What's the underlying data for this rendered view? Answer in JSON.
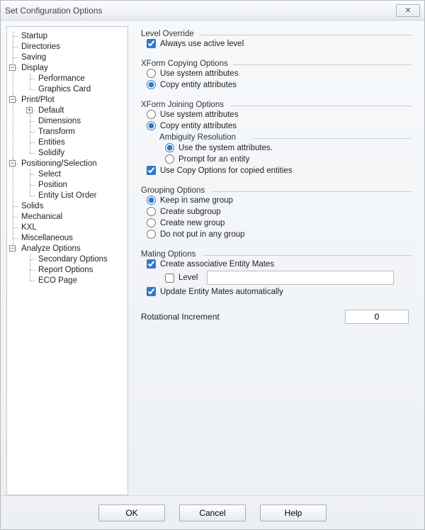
{
  "window": {
    "title": "Set Configuration Options"
  },
  "tree": {
    "items": [
      {
        "label": "Startup"
      },
      {
        "label": "Directories"
      },
      {
        "label": "Saving"
      },
      {
        "label": "Display",
        "expander": "-",
        "children": [
          {
            "label": "Performance"
          },
          {
            "label": "Graphics Card"
          }
        ]
      },
      {
        "label": "Print/Plot",
        "expander": "-",
        "children": [
          {
            "label": "Default",
            "expander": "+"
          },
          {
            "label": "Dimensions"
          },
          {
            "label": "Transform"
          },
          {
            "label": "Entities"
          },
          {
            "label": "Solidify"
          }
        ]
      },
      {
        "label": "Positioning/Selection",
        "expander": "-",
        "children": [
          {
            "label": "Select"
          },
          {
            "label": "Position"
          },
          {
            "label": "Entity List Order"
          }
        ]
      },
      {
        "label": "Solids"
      },
      {
        "label": "Mechanical"
      },
      {
        "label": "KXL"
      },
      {
        "label": "Miscellaneous"
      },
      {
        "label": "Analyze Options",
        "expander": "-",
        "children": [
          {
            "label": "Secondary Options"
          },
          {
            "label": "Report Options"
          },
          {
            "label": "ECO Page"
          }
        ]
      }
    ]
  },
  "sections": {
    "levelOverride": {
      "legend": "Level Override",
      "alwaysActive": {
        "label": "Always use active level",
        "checked": true
      }
    },
    "xformCopy": {
      "legend": "XForm Copying Options",
      "useSystem": {
        "label": "Use system attributes",
        "selected": false
      },
      "copyEntity": {
        "label": "Copy entity attributes",
        "selected": true
      }
    },
    "xformJoin": {
      "legend": "XForm Joining Options",
      "useSystem": {
        "label": "Use system attributes",
        "selected": false
      },
      "copyEntity": {
        "label": "Copy entity attributes",
        "selected": true
      },
      "ambiguity": {
        "legend": "Ambiguity Resolution",
        "useSystem": {
          "label": "Use the system attributes.",
          "selected": true
        },
        "prompt": {
          "label": "Prompt for an entity",
          "selected": false
        }
      },
      "useCopyOptions": {
        "label": "Use Copy Options for copied entities",
        "checked": true
      }
    },
    "grouping": {
      "legend": "Grouping Options",
      "keep": {
        "label": "Keep in same group",
        "selected": true
      },
      "sub": {
        "label": "Create subgroup",
        "selected": false
      },
      "new": {
        "label": "Create new group",
        "selected": false
      },
      "none": {
        "label": "Do not put in any group",
        "selected": false
      }
    },
    "mating": {
      "legend": "Mating Options",
      "createAssoc": {
        "label": "Create associative Entity Mates",
        "checked": true
      },
      "level": {
        "label": "Level",
        "checked": false,
        "value": ""
      },
      "updateAuto": {
        "label": "Update Entity Mates automatically",
        "checked": true
      }
    },
    "rotIncrement": {
      "label": "Rotational Increment",
      "value": "0"
    }
  },
  "footer": {
    "ok": "OK",
    "cancel": "Cancel",
    "help": "Help"
  }
}
